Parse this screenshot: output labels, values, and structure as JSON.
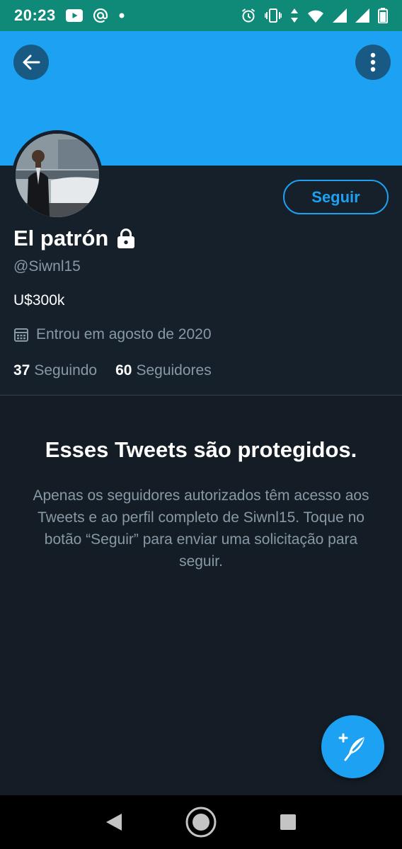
{
  "status_bar": {
    "time": "20:23",
    "left_icons": [
      "youtube-icon",
      "at-sign-icon",
      "dot-icon"
    ],
    "right_icons": [
      "alarm-icon",
      "vibrate-icon",
      "data-arrows-icon",
      "wifi-icon",
      "signal-icon",
      "signal-icon",
      "battery-icon"
    ]
  },
  "header": {
    "banner_color": "#1da1f2",
    "back_icon": "arrow-left-icon",
    "more_icon": "more-vertical-icon"
  },
  "profile": {
    "name": "El patrón",
    "handle": "@Siwnl15",
    "bio": "U$300k",
    "joined": "Entrou em agosto de 2020",
    "follow_label": "Seguir",
    "following_count": "37",
    "following_label": "Seguindo",
    "followers_count": "60",
    "followers_label": "Seguidores",
    "locked": true
  },
  "protected": {
    "title": "Esses Tweets são protegidos.",
    "description": "Apenas os seguidores autorizados têm acesso aos Tweets e ao perfil completo de Siwnl15. Toque no botão “Seguir” para enviar uma solicitação para seguir."
  },
  "fab": {
    "icon": "compose-tweet-icon"
  },
  "nav_bar": {
    "icons": [
      "nav-back-icon",
      "nav-home-icon",
      "nav-recents-icon"
    ]
  },
  "colors": {
    "accent": "#1da1f2",
    "background": "#15202b",
    "status_bar": "#108a78",
    "secondary_text": "#8899a6"
  }
}
